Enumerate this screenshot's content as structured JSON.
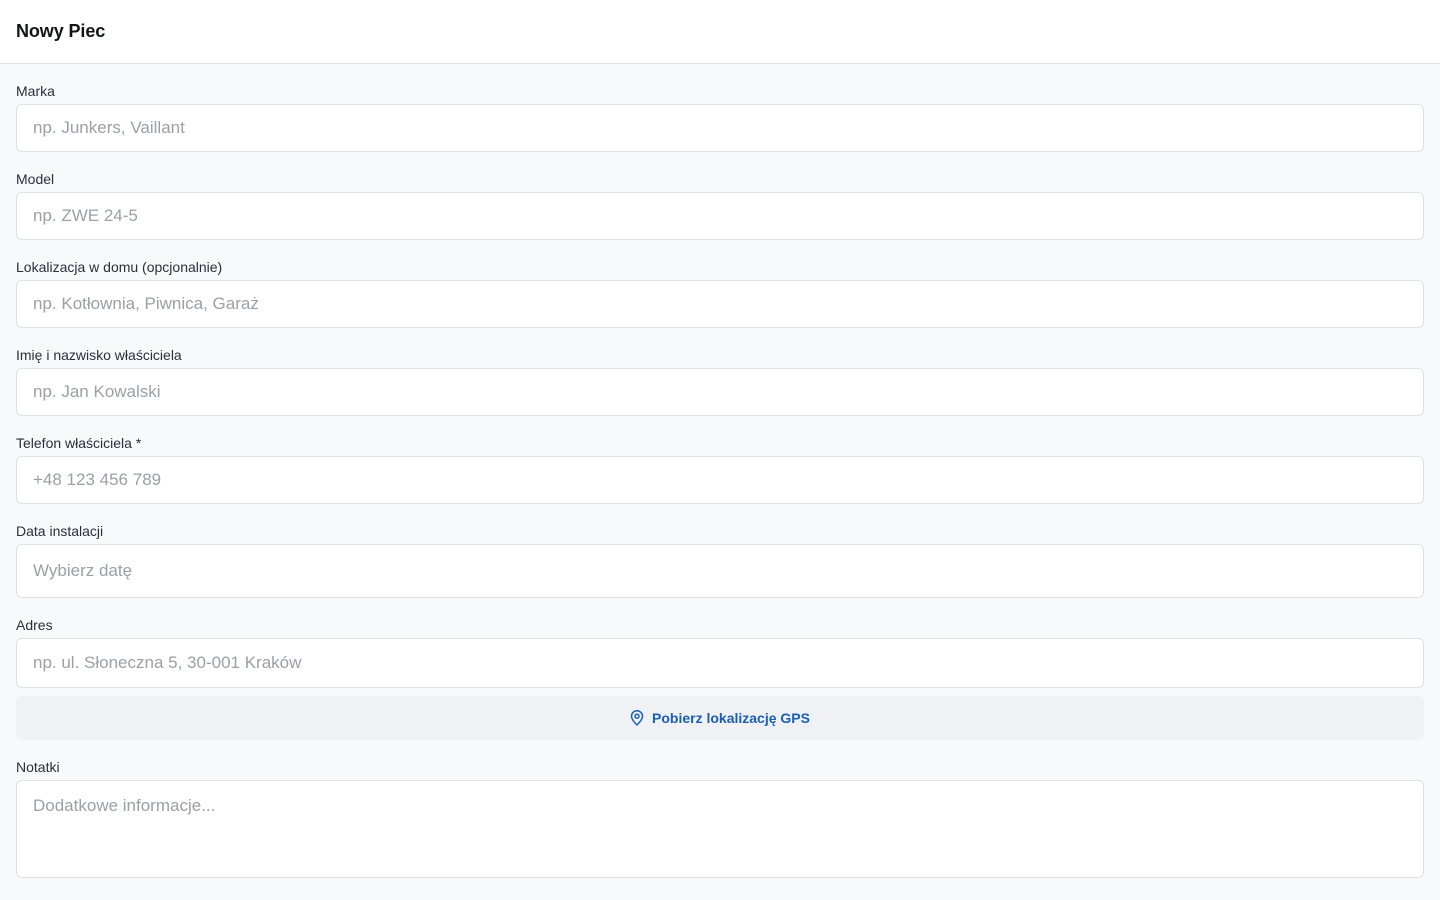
{
  "header": {
    "title": "Nowy Piec"
  },
  "fields": [
    {
      "label": "Marka",
      "placeholder": "np. Junkers, Vaillant"
    },
    {
      "label": "Model",
      "placeholder": "np. ZWE 24-5"
    },
    {
      "label": "Lokalizacja w domu (opcjonalnie)",
      "placeholder": "np. Kotłownia, Piwnica, Garaż"
    },
    {
      "label": "Imię i nazwisko właściciela",
      "placeholder": "np. Jan Kowalski"
    },
    {
      "label": "Telefon właściciela *",
      "placeholder": "+48 123 456 789"
    },
    {
      "label": "Data instalacji",
      "placeholder": "Wybierz datę"
    },
    {
      "label": "Adres",
      "placeholder": "np. ul. Słoneczna 5, 30-001 Kraków"
    }
  ],
  "gps": {
    "label": "Pobierz lokalizację GPS",
    "icon": "map-pin-icon",
    "color": "#1a5fb4"
  },
  "notes": {
    "label": "Notatki",
    "placeholder": "Dodatkowe informacje..."
  }
}
